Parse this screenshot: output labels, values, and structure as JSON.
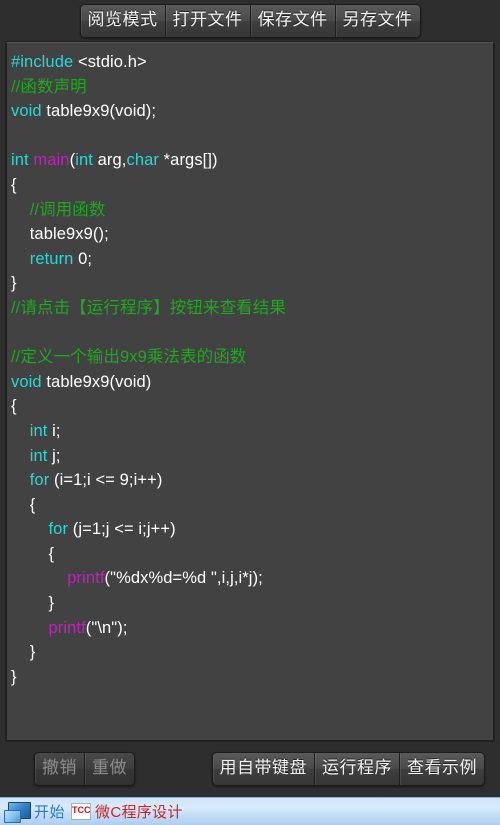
{
  "app": {
    "title": "微C程序设计"
  },
  "toolbar_top": {
    "buttons": [
      {
        "label": "阅览模式",
        "name": "read-mode-button",
        "disabled": false
      },
      {
        "label": "打开文件",
        "name": "open-file-button",
        "disabled": false
      },
      {
        "label": "保存文件",
        "name": "save-file-button",
        "disabled": false
      },
      {
        "label": "另存文件",
        "name": "save-as-file-button",
        "disabled": false
      }
    ]
  },
  "editor": {
    "language": "c",
    "colors": {
      "background": "#424242",
      "plain": "#ffffff",
      "keyword": "#29d7d7",
      "comment": "#1ea81e",
      "function": "#c020c0"
    },
    "lines": [
      [
        {
          "t": "#include ",
          "c": "kw"
        },
        {
          "t": "<stdio.h>",
          "c": "pl"
        }
      ],
      [
        {
          "t": "//函数声明",
          "c": "cmt"
        }
      ],
      [
        {
          "t": "void",
          "c": "kw"
        },
        {
          "t": " table9x9(void);",
          "c": "pl"
        }
      ],
      [
        {
          "t": "",
          "c": "pl"
        }
      ],
      [
        {
          "t": "int",
          "c": "kw"
        },
        {
          "t": " ",
          "c": "pl"
        },
        {
          "t": "main",
          "c": "fn"
        },
        {
          "t": "(",
          "c": "pl"
        },
        {
          "t": "int",
          "c": "kw"
        },
        {
          "t": " arg,",
          "c": "pl"
        },
        {
          "t": "char",
          "c": "kw"
        },
        {
          "t": " *args[])",
          "c": "pl"
        }
      ],
      [
        {
          "t": "{",
          "c": "pl"
        }
      ],
      [
        {
          "t": "    //调用函数",
          "c": "cmt"
        }
      ],
      [
        {
          "t": "    table9x9();",
          "c": "pl"
        }
      ],
      [
        {
          "t": "    ",
          "c": "pl"
        },
        {
          "t": "return",
          "c": "kw"
        },
        {
          "t": " 0;",
          "c": "pl"
        }
      ],
      [
        {
          "t": "}",
          "c": "pl"
        }
      ],
      [
        {
          "t": "//请点击【运行程序】按钮来查看结果",
          "c": "cmt"
        }
      ],
      [
        {
          "t": "",
          "c": "pl"
        }
      ],
      [
        {
          "t": "//定义一个输出9x9乘法表的函数",
          "c": "cmt"
        }
      ],
      [
        {
          "t": "void",
          "c": "kw"
        },
        {
          "t": " table9x9(void)",
          "c": "pl"
        }
      ],
      [
        {
          "t": "{",
          "c": "pl"
        }
      ],
      [
        {
          "t": "    ",
          "c": "pl"
        },
        {
          "t": "int",
          "c": "kw"
        },
        {
          "t": " i;",
          "c": "pl"
        }
      ],
      [
        {
          "t": "    ",
          "c": "pl"
        },
        {
          "t": "int",
          "c": "kw"
        },
        {
          "t": " j;",
          "c": "pl"
        }
      ],
      [
        {
          "t": "    ",
          "c": "pl"
        },
        {
          "t": "for",
          "c": "kw"
        },
        {
          "t": " (i=1;i <= 9;i++)",
          "c": "pl"
        }
      ],
      [
        {
          "t": "    {",
          "c": "pl"
        }
      ],
      [
        {
          "t": "        ",
          "c": "pl"
        },
        {
          "t": "for",
          "c": "kw"
        },
        {
          "t": " (j=1;j <= i;j++)",
          "c": "pl"
        }
      ],
      [
        {
          "t": "        {",
          "c": "pl"
        }
      ],
      [
        {
          "t": "            ",
          "c": "pl"
        },
        {
          "t": "printf",
          "c": "fn"
        },
        {
          "t": "(\"%dx%d=%d \",i,j,i*j);",
          "c": "pl"
        }
      ],
      [
        {
          "t": "        }",
          "c": "pl"
        }
      ],
      [
        {
          "t": "        ",
          "c": "pl"
        },
        {
          "t": "printf",
          "c": "fn"
        },
        {
          "t": "(\"\\n\");",
          "c": "pl"
        }
      ],
      [
        {
          "t": "    }",
          "c": "pl"
        }
      ],
      [
        {
          "t": "}",
          "c": "pl"
        }
      ]
    ]
  },
  "toolbar_bottom": {
    "left_buttons": [
      {
        "label": "撤销",
        "name": "undo-button",
        "disabled": true
      },
      {
        "label": "重做",
        "name": "redo-button",
        "disabled": true
      }
    ],
    "right_buttons": [
      {
        "label": "用自带键盘",
        "name": "builtin-keyboard-button",
        "disabled": false
      },
      {
        "label": "运行程序",
        "name": "run-program-button",
        "disabled": false
      },
      {
        "label": "查看示例",
        "name": "view-example-button",
        "disabled": false
      }
    ]
  },
  "taskbar": {
    "start_label": "开始",
    "task_icon_label": "TCC",
    "task_title": "微C程序设计",
    "accent": "#d62020",
    "start_color": "#2d79c4"
  }
}
